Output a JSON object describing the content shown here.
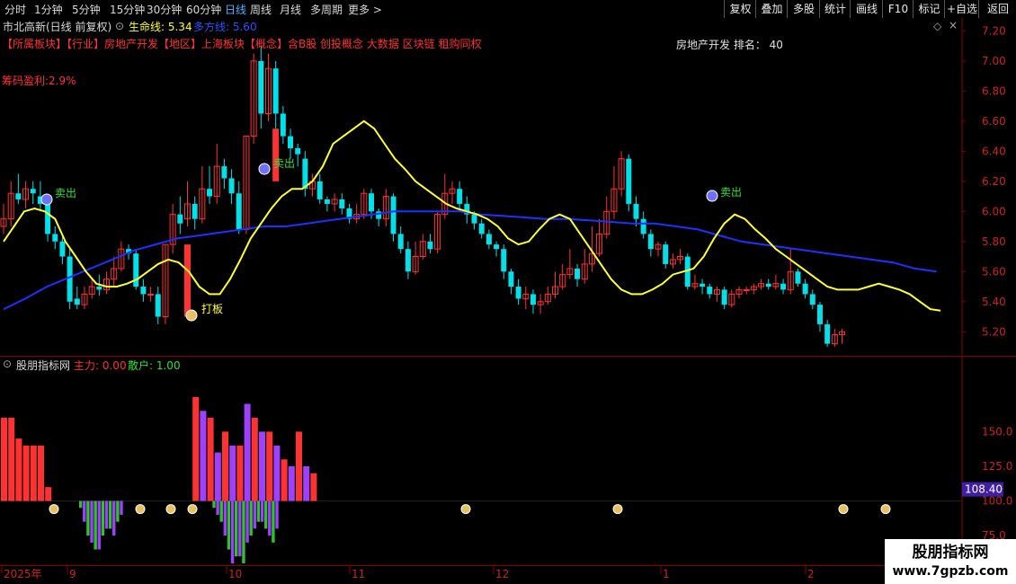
{
  "toolbar": {
    "timeframes": [
      "分时",
      "1分钟",
      "5分钟",
      "15分钟",
      "30分钟",
      "60分钟",
      "日线",
      "周线",
      "月线",
      "多周期",
      "更多 >"
    ],
    "active_timeframe": "日线",
    "right_buttons": [
      "复权",
      "叠加",
      "多股",
      "统计",
      "画线",
      "F10",
      "标记",
      "+自选",
      "返回"
    ]
  },
  "header": {
    "title": "市北高新(日线 前复权)",
    "lifeline_label": "生命线: 5.34",
    "multiline_label": "多方线: 5.60",
    "tags": "【所属板块】【行业】房地产开发【地区】上海板块【概念】含B股 创投概念 大数据 区块链 租购同权",
    "ranking": "房地产开发 排名： 40",
    "chip_profit": "筹码盈利:2.9%"
  },
  "annotations": {
    "sell": "卖出",
    "limit_up": "打板"
  },
  "price_axis": [
    "7.20",
    "7.00",
    "6.80",
    "6.60",
    "6.40",
    "6.20",
    "6.00",
    "5.80",
    "5.60",
    "5.40",
    "5.20"
  ],
  "indicator": {
    "title": "股朋指标网",
    "main_force_label": "主力: 0.00",
    "retail_label": "散户: 1.00",
    "axis": [
      "150.0",
      "125.0",
      "100.0",
      "75.0"
    ],
    "current_value": "108.40"
  },
  "date_axis": [
    "2025年",
    "9",
    "10",
    "11",
    "12",
    "1",
    "2"
  ],
  "watermark": {
    "title": "股朋指标网",
    "url": "www.7gpzb.com"
  },
  "colors": {
    "up": "#ff3232",
    "down": "#00e0e8",
    "ma_yellow": "#ffff30",
    "ma_blue": "#2030ff",
    "purple": "#a040ff",
    "green": "#30c030",
    "grid": "#700000"
  },
  "chart_data": {
    "type": "candlestick",
    "price_range": [
      5.1,
      7.25
    ],
    "candles": [
      [
        5.9,
        5.95,
        6.05,
        5.85
      ],
      [
        5.95,
        6.12,
        6.2,
        5.9
      ],
      [
        6.12,
        6.08,
        6.25,
        6.05
      ],
      [
        6.08,
        6.15,
        6.2,
        6.02
      ],
      [
        6.15,
        6.12,
        6.2,
        6.05
      ],
      [
        6.1,
        6.05,
        6.2,
        6.0
      ],
      [
        6.05,
        5.85,
        6.1,
        5.8
      ],
      [
        5.85,
        5.8,
        5.9,
        5.75
      ],
      [
        5.8,
        5.7,
        5.85,
        5.65
      ],
      [
        5.7,
        5.4,
        5.75,
        5.35
      ],
      [
        5.42,
        5.38,
        5.5,
        5.35
      ],
      [
        5.38,
        5.45,
        5.5,
        5.35
      ],
      [
        5.45,
        5.5,
        5.55,
        5.42
      ],
      [
        5.5,
        5.48,
        5.58,
        5.44
      ],
      [
        5.48,
        5.55,
        5.6,
        5.45
      ],
      [
        5.55,
        5.62,
        5.7,
        5.5
      ],
      [
        5.62,
        5.75,
        5.8,
        5.6
      ],
      [
        5.75,
        5.72,
        5.78,
        5.68
      ],
      [
        5.72,
        5.5,
        5.75,
        5.48
      ],
      [
        5.5,
        5.45,
        5.55,
        5.4
      ],
      [
        5.45,
        5.45,
        5.5,
        5.4
      ],
      [
        5.45,
        5.3,
        5.5,
        5.25
      ],
      [
        5.3,
        5.78,
        5.78,
        5.25
      ],
      [
        5.78,
        5.98,
        6.05,
        5.72
      ],
      [
        5.98,
        5.92,
        6.1,
        5.85
      ],
      [
        5.95,
        6.05,
        6.2,
        5.9
      ],
      [
        6.05,
        5.95,
        6.1,
        5.88
      ],
      [
        5.95,
        6.15,
        6.3,
        5.92
      ],
      [
        6.15,
        6.1,
        6.3,
        6.05
      ],
      [
        6.1,
        6.3,
        6.45,
        6.05
      ],
      [
        6.3,
        6.22,
        6.35,
        6.15
      ],
      [
        6.22,
        6.12,
        6.28,
        6.05
      ],
      [
        6.12,
        5.88,
        6.2,
        5.85
      ],
      [
        5.88,
        6.5,
        6.5,
        5.85
      ],
      [
        6.5,
        7.0,
        7.05,
        6.45
      ],
      [
        7.0,
        6.65,
        7.1,
        6.55
      ],
      [
        6.65,
        6.95,
        7.05,
        6.6
      ],
      [
        6.95,
        6.65,
        7.0,
        6.55
      ],
      [
        6.65,
        6.5,
        6.7,
        6.45
      ],
      [
        6.5,
        6.42,
        6.55,
        6.35
      ],
      [
        6.42,
        6.38,
        6.45,
        6.3
      ],
      [
        6.35,
        6.15,
        6.4,
        6.1
      ],
      [
        6.15,
        6.2,
        6.25,
        6.1
      ],
      [
        6.2,
        6.08,
        6.25,
        6.05
      ],
      [
        6.08,
        6.05,
        6.1,
        6.0
      ],
      [
        6.05,
        6.08,
        6.12,
        6.0
      ],
      [
        6.08,
        6.02,
        6.12,
        5.98
      ],
      [
        6.02,
        5.95,
        6.05,
        5.92
      ],
      [
        5.95,
        5.98,
        6.05,
        5.92
      ],
      [
        5.98,
        6.12,
        6.15,
        5.95
      ],
      [
        6.12,
        6.0,
        6.15,
        5.95
      ],
      [
        6.0,
        5.95,
        6.02,
        5.9
      ],
      [
        5.95,
        6.1,
        6.15,
        5.9
      ],
      [
        6.1,
        5.85,
        6.12,
        5.8
      ],
      [
        5.85,
        5.75,
        5.9,
        5.72
      ],
      [
        5.75,
        5.6,
        5.8,
        5.55
      ],
      [
        5.6,
        5.7,
        5.8,
        5.58
      ],
      [
        5.7,
        5.8,
        5.85,
        5.68
      ],
      [
        5.8,
        5.75,
        5.85,
        5.72
      ],
      [
        5.75,
        5.98,
        6.0,
        5.72
      ],
      [
        5.98,
        6.12,
        6.25,
        5.95
      ],
      [
        6.12,
        6.15,
        6.2,
        6.05
      ],
      [
        6.15,
        6.05,
        6.2,
        6.0
      ],
      [
        6.05,
        5.98,
        6.1,
        5.92
      ],
      [
        5.98,
        5.92,
        6.0,
        5.88
      ],
      [
        5.92,
        5.85,
        5.95,
        5.82
      ],
      [
        5.85,
        5.78,
        5.88,
        5.75
      ],
      [
        5.78,
        5.75,
        5.8,
        5.7
      ],
      [
        5.75,
        5.6,
        5.78,
        5.55
      ],
      [
        5.6,
        5.5,
        5.62,
        5.45
      ],
      [
        5.5,
        5.42,
        5.55,
        5.38
      ],
      [
        5.42,
        5.45,
        5.5,
        5.35
      ],
      [
        5.45,
        5.38,
        5.48,
        5.32
      ],
      [
        5.38,
        5.4,
        5.45,
        5.32
      ],
      [
        5.4,
        5.45,
        5.5,
        5.38
      ],
      [
        5.45,
        5.5,
        5.6,
        5.42
      ],
      [
        5.5,
        5.58,
        5.65,
        5.48
      ],
      [
        5.58,
        5.62,
        5.75,
        5.55
      ],
      [
        5.62,
        5.55,
        5.65,
        5.5
      ],
      [
        5.55,
        5.65,
        5.75,
        5.52
      ],
      [
        5.65,
        5.72,
        5.9,
        5.6
      ],
      [
        5.72,
        5.85,
        5.95,
        5.7
      ],
      [
        5.85,
        6.0,
        6.1,
        5.82
      ],
      [
        6.0,
        6.15,
        6.3,
        5.95
      ],
      [
        6.15,
        6.35,
        6.4,
        6.1
      ],
      [
        6.35,
        6.05,
        6.38,
        6.0
      ],
      [
        6.05,
        5.95,
        6.1,
        5.9
      ],
      [
        5.95,
        5.85,
        6.0,
        5.82
      ],
      [
        5.85,
        5.75,
        5.88,
        5.7
      ],
      [
        5.75,
        5.78,
        5.8,
        5.7
      ],
      [
        5.78,
        5.65,
        5.8,
        5.62
      ],
      [
        5.65,
        5.68,
        5.72,
        5.62
      ],
      [
        5.68,
        5.7,
        5.75,
        5.65
      ],
      [
        5.7,
        5.5,
        5.72,
        5.48
      ],
      [
        5.5,
        5.52,
        5.58,
        5.48
      ],
      [
        5.52,
        5.5,
        5.55,
        5.45
      ],
      [
        5.5,
        5.45,
        5.52,
        5.42
      ],
      [
        5.45,
        5.48,
        5.5,
        5.4
      ],
      [
        5.48,
        5.38,
        5.5,
        5.35
      ],
      [
        5.38,
        5.45,
        5.48,
        5.36
      ],
      [
        5.45,
        5.48,
        5.5,
        5.42
      ],
      [
        5.48,
        5.48,
        5.5,
        5.45
      ],
      [
        5.48,
        5.5,
        5.52,
        5.45
      ],
      [
        5.5,
        5.52,
        5.55,
        5.48
      ],
      [
        5.52,
        5.5,
        5.55,
        5.48
      ],
      [
        5.5,
        5.52,
        5.58,
        5.48
      ],
      [
        5.52,
        5.48,
        5.55,
        5.45
      ],
      [
        5.48,
        5.6,
        5.75,
        5.45
      ],
      [
        5.6,
        5.52,
        5.62,
        5.5
      ],
      [
        5.52,
        5.45,
        5.55,
        5.42
      ],
      [
        5.45,
        5.38,
        5.48,
        5.35
      ],
      [
        5.38,
        5.25,
        5.4,
        5.2
      ],
      [
        5.25,
        5.12,
        5.28,
        5.1
      ],
      [
        5.12,
        5.18,
        5.22,
        5.1
      ],
      [
        5.18,
        5.2,
        5.22,
        5.12
      ]
    ],
    "ma_lifeline": [
      5.8,
      5.9,
      6.0,
      6.02,
      6.0,
      5.95,
      5.8,
      5.7,
      5.6,
      5.52,
      5.5,
      5.5,
      5.52,
      5.55,
      5.6,
      5.65,
      5.68,
      5.66,
      5.6,
      5.5,
      5.45,
      5.45,
      5.55,
      5.68,
      5.82,
      5.92,
      6.02,
      6.1,
      6.15,
      6.15,
      6.2,
      6.3,
      6.45,
      6.5,
      6.55,
      6.6,
      6.55,
      6.45,
      6.35,
      6.28,
      6.2,
      6.15,
      6.1,
      6.05,
      6.02,
      6.0,
      5.98,
      5.95,
      5.9,
      5.82,
      5.78,
      5.8,
      5.88,
      5.95,
      5.98,
      5.95,
      5.85,
      5.75,
      5.65,
      5.55,
      5.48,
      5.45,
      5.45,
      5.48,
      5.52,
      5.58,
      5.6,
      5.62,
      5.7,
      5.82,
      5.92,
      5.98,
      5.95,
      5.88,
      5.82,
      5.75,
      5.7,
      5.65,
      5.6,
      5.55,
      5.5,
      5.48,
      5.48,
      5.48,
      5.5,
      5.52,
      5.5,
      5.48,
      5.45,
      5.4,
      5.35,
      5.34
    ],
    "ma_multiline": [
      5.35,
      5.42,
      5.5,
      5.56,
      5.62,
      5.68,
      5.74,
      5.78,
      5.82,
      5.84,
      5.86,
      5.88,
      5.9,
      5.9,
      5.92,
      5.94,
      5.96,
      5.98,
      6.0,
      6.0,
      6.0,
      6.0,
      5.98,
      5.97,
      5.96,
      5.95,
      5.95,
      5.94,
      5.93,
      5.92,
      5.92,
      5.9,
      5.88,
      5.84,
      5.8,
      5.78,
      5.76,
      5.74,
      5.72,
      5.7,
      5.68,
      5.66,
      5.62,
      5.6
    ],
    "indicator_bars": {
      "range": [
        55,
        195
      ],
      "main_force": [
        160,
        160,
        145,
        140,
        140,
        140,
        110,
        0,
        0,
        0,
        0,
        0,
        0,
        0,
        0,
        0,
        0,
        0,
        0,
        0,
        0,
        0,
        0,
        0,
        0,
        0,
        175,
        165,
        160,
        135,
        150,
        140,
        140,
        170,
        160,
        150,
        150,
        140,
        130,
        125,
        150,
        125,
        120,
        0,
        0,
        0,
        0,
        0,
        0,
        0,
        0,
        0,
        0,
        0,
        0,
        0,
        0,
        0,
        0,
        0,
        0,
        0,
        0,
        0,
        0,
        0,
        0,
        0,
        0,
        0,
        0,
        0,
        0,
        0,
        0,
        0,
        0,
        0,
        0,
        0,
        0,
        0,
        0,
        0,
        0,
        0,
        0,
        0,
        0,
        0,
        0,
        0,
        0,
        0,
        0,
        0,
        0,
        0,
        0,
        0,
        0,
        0,
        0,
        0,
        0,
        0,
        0,
        0,
        0,
        0,
        0,
        0,
        0,
        0,
        0,
        0,
        0,
        0,
        0
      ],
      "retail": [
        0,
        0,
        0,
        0,
        0,
        0,
        0,
        0,
        95,
        85,
        75,
        70,
        65,
        65,
        75,
        80,
        80,
        75,
        85,
        90,
        0,
        100,
        0,
        115,
        135,
        135,
        0,
        0,
        0,
        0,
        0,
        0,
        0,
        0,
        0,
        0,
        0,
        0,
        0,
        0,
        0,
        0,
        0,
        0,
        95,
        90,
        85,
        75,
        65,
        55,
        60,
        60,
        55,
        70,
        75,
        80,
        85,
        85,
        80,
        75,
        70,
        80,
        0,
        100,
        0,
        0,
        0,
        0,
        0,
        0,
        0,
        0,
        0,
        0,
        0,
        0,
        0,
        0,
        0,
        0,
        0,
        0,
        0,
        0,
        0,
        0,
        0,
        0,
        0,
        0,
        0,
        0,
        0,
        0,
        0,
        0,
        0,
        0,
        0,
        0,
        0,
        0,
        0,
        0,
        0,
        0,
        0,
        0,
        0,
        0,
        0,
        0,
        0,
        0,
        0,
        0,
        0,
        0,
        0
      ]
    }
  }
}
